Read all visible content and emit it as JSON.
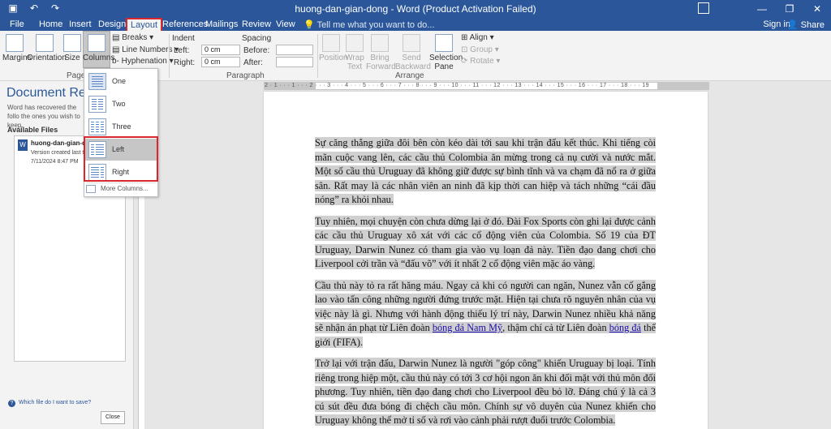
{
  "window": {
    "title": "huong-dan-gian-dong - Word (Product Activation Failed)",
    "controls": [
      "—",
      "❐",
      "✕"
    ]
  },
  "qat": {
    "save_icon": "save-icon",
    "undo_icon": "undo-icon",
    "redo_icon": "redo-icon"
  },
  "tabs": [
    {
      "label": "File"
    },
    {
      "label": "Home"
    },
    {
      "label": "Insert"
    },
    {
      "label": "Design"
    },
    {
      "label": "Layout"
    },
    {
      "label": "References"
    },
    {
      "label": "Mailings"
    },
    {
      "label": "Review"
    },
    {
      "label": "View"
    }
  ],
  "tell_me": "Tell me what you want to do...",
  "sign_in": "Sign in",
  "share": "Share",
  "ribbon": {
    "page_setup": {
      "margins": "Margins",
      "orientation": "Orientation",
      "size": "Size",
      "columns": "Columns",
      "breaks": "Breaks",
      "line_numbers": "Line Numbers",
      "hyphenation": "Hyphenation",
      "label": "Page Setup"
    },
    "paragraph": {
      "indent": "Indent",
      "left": "Left:",
      "left_value": "0 cm",
      "right": "Right:",
      "right_value": "0 cm",
      "spacing": "Spacing",
      "before": "Before:",
      "after": "After:",
      "label": "Paragraph"
    },
    "arrange": {
      "position": "Position",
      "wrap_text": "Wrap Text",
      "bring_forward": "Bring Forward",
      "send_backward": "Send Backward",
      "selection_pane": "Selection Pane",
      "align": "Align",
      "group": "Group",
      "rotate": "Rotate",
      "label": "Arrange"
    }
  },
  "columns_menu": {
    "items": [
      {
        "label": "One"
      },
      {
        "label": "Two"
      },
      {
        "label": "Three"
      },
      {
        "label": "Left"
      },
      {
        "label": "Right"
      }
    ],
    "more": "More Columns..."
  },
  "recovery": {
    "title": "Document Reco",
    "desc": "Word has recovered the follo the ones you wish to keep.",
    "available": "Available Files",
    "file_name": "huong-dan-gian-d",
    "file_meta1": "Version created last t",
    "file_meta2": "7/11/2024 8:47 PM",
    "help": "Which file do I want to save?",
    "close": "Close"
  },
  "document": {
    "p1": "Sự căng thẳng giữa đôi bên còn kéo dài tới sau khi trận đấu kết thúc. Khi tiếng còi mãn cuộc vang lên, các cầu thủ Colombia ăn mừng trong cả nụ cười và nước mắt. Một số cầu thủ Uruguay đã không giữ được sự bình tĩnh và va chạm đã nổ ra ở giữa sân. Rất may là các nhân viên an ninh đã kịp thời can hiệp và tách những “cái đầu nóng” ra khỏi nhau.",
    "p2": "Tuy nhiên, mọi chuyện còn chưa dừng lại ở đó. Đài Fox Sports còn ghi lại được cảnh các cầu thủ Uruguay xô xát với các cổ động viên của Colombia. Số 19 của ĐT Uruguay, Darwin Nunez có tham gia vào vụ loạn đả này. Tiền đạo đang chơi cho Liverpool cởi trần và “đấu võ” với ít nhất 2 cổ động viên mặc áo vàng.",
    "p3_a": "Cầu thủ này tỏ ra rất hăng máu. Ngay cả khi có người can ngăn, Nunez vẫn cố gắng lao vào tấn công những người đứng trước mặt. Hiện tại chưa rõ nguyên nhân của vụ việc này là gì. Nhưng với hành động thiếu lý trí này, Darwin Nunez nhiều khả năng sẽ nhận án phạt từ Liên đoàn ",
    "p3_link1": "bóng đá Nam Mỹ",
    "p3_b": ", thậm chí cả từ Liên đoàn ",
    "p3_link2": "bóng đá",
    "p3_c": " thế giới (FIFA).",
    "p4": "Trở lại với trận đấu, Darwin Nunez là người \"góp công\" khiến Uruguay bị loại. Tính riêng trong hiệp một, cầu thủ này có tới 3 cơ hội ngon ăn khi đối mặt với thủ môn đối phương. Tuy nhiên, tiền đạo đang chơi cho Liverpool đều bỏ lỡ. Đáng chú ý là cả 3 cú sút đều đưa bóng đi chệch cầu môn. Chính sự vô duyên của Nunez khiến cho Uruguay không thể mở tỉ số và rơi vào cảnh phải rượt đuổi trước Colombia."
  },
  "colors": {
    "accent": "#2b579a",
    "highlight": "#d0d0d0",
    "callout": "#d9272e"
  }
}
